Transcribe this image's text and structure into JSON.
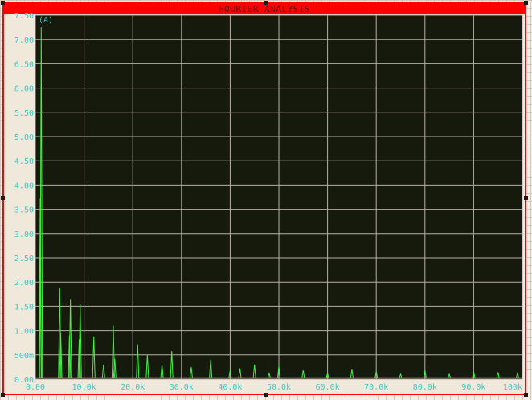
{
  "window": {
    "title": "FOURIER ANALYSIS",
    "frame_color": "#ff0000",
    "plot_bg": "#161a0c",
    "trace_color": "#41f23e",
    "grid_color": "#b8b0a8",
    "axis_text_color": "#3cc7c7"
  },
  "chart_data": {
    "type": "line",
    "title": "FOURIER ANALYSIS",
    "ylabel": "(A)",
    "xlabel": "",
    "xlim": [
      0,
      100000
    ],
    "ylim": [
      0,
      7.5
    ],
    "grid": true,
    "x_ticks": [
      "0.00",
      "10.0k",
      "20.0k",
      "30.0k",
      "40.0k",
      "50.0k",
      "60.0k",
      "70.0k",
      "80.0k",
      "90.0k",
      "100k"
    ],
    "y_ticks": [
      "0.00",
      "500m",
      "1.00",
      "1.50",
      "2.00",
      "2.50",
      "3.00",
      "3.50",
      "4.00",
      "4.50",
      "5.00",
      "5.50",
      "6.00",
      "6.50",
      "7.00",
      "7.50"
    ],
    "series": [
      {
        "peaks": [
          {
            "x": 1000,
            "y": 3.72
          },
          {
            "x": 1200,
            "y": 7.25
          },
          {
            "x": 5000,
            "y": 1.88
          },
          {
            "x": 5200,
            "y": 0.95
          },
          {
            "x": 7000,
            "y": 0.9
          },
          {
            "x": 7200,
            "y": 1.65
          },
          {
            "x": 9000,
            "y": 0.82
          },
          {
            "x": 9200,
            "y": 1.55
          },
          {
            "x": 12000,
            "y": 0.88
          },
          {
            "x": 14000,
            "y": 0.3
          },
          {
            "x": 16000,
            "y": 1.1
          },
          {
            "x": 16300,
            "y": 0.42
          },
          {
            "x": 21000,
            "y": 0.72
          },
          {
            "x": 23000,
            "y": 0.5
          },
          {
            "x": 26000,
            "y": 0.3
          },
          {
            "x": 28000,
            "y": 0.58
          },
          {
            "x": 32000,
            "y": 0.25
          },
          {
            "x": 36000,
            "y": 0.4
          },
          {
            "x": 40000,
            "y": 0.18
          },
          {
            "x": 42000,
            "y": 0.22
          },
          {
            "x": 45000,
            "y": 0.3
          },
          {
            "x": 48000,
            "y": 0.12
          },
          {
            "x": 50000,
            "y": 0.27
          },
          {
            "x": 55000,
            "y": 0.18
          },
          {
            "x": 60000,
            "y": 0.12
          },
          {
            "x": 65000,
            "y": 0.2
          },
          {
            "x": 70000,
            "y": 0.16
          },
          {
            "x": 75000,
            "y": 0.1
          },
          {
            "x": 80000,
            "y": 0.18
          },
          {
            "x": 85000,
            "y": 0.1
          },
          {
            "x": 90000,
            "y": 0.16
          },
          {
            "x": 95000,
            "y": 0.14
          },
          {
            "x": 99000,
            "y": 0.12
          }
        ]
      }
    ]
  }
}
